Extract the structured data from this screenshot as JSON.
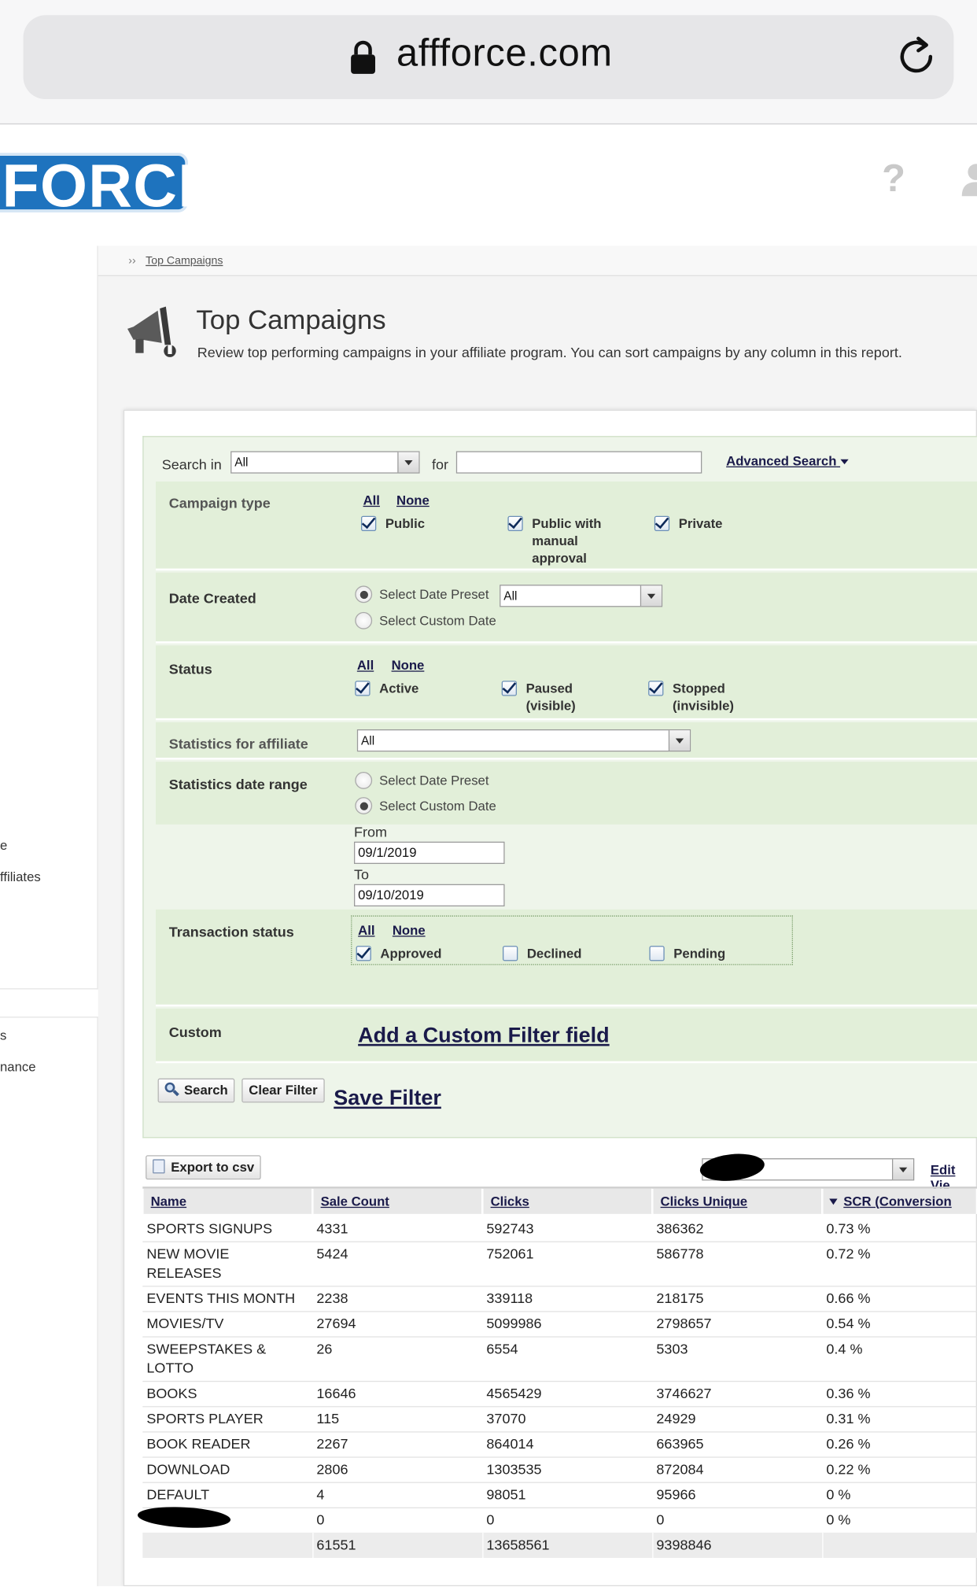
{
  "browser": {
    "url": "affforce.com"
  },
  "header": {
    "logo_text": "FORCE",
    "help_glyph": "?"
  },
  "sidebar": {
    "frag1": "e",
    "frag2": "ffiliates",
    "frag3": "s",
    "frag4": "nance"
  },
  "breadcrumb": {
    "arrow": "››",
    "current": "Top Campaigns"
  },
  "page": {
    "title": "Top Campaigns",
    "description": "Review top performing campaigns in your affiliate program. You can sort campaigns by any column in this report."
  },
  "search": {
    "label": "Search in",
    "scope_value": "All",
    "for_label": "for",
    "query_value": "",
    "advanced_label": "Advanced Search"
  },
  "filters": {
    "campaign_type": {
      "label": "Campaign type",
      "all": "All",
      "none": "None",
      "options": [
        {
          "line1": "Public",
          "line2": "",
          "line3": "",
          "checked": true
        },
        {
          "line1": "Public with",
          "line2": "manual",
          "line3": "approval",
          "checked": true
        },
        {
          "line1": "Private",
          "line2": "",
          "line3": "",
          "checked": true
        }
      ]
    },
    "date_created": {
      "label": "Date Created",
      "preset_label": "Select Date Preset",
      "preset_value": "All",
      "custom_label": "Select Custom Date",
      "selected": "preset"
    },
    "status": {
      "label": "Status",
      "all": "All",
      "none": "None",
      "options": [
        {
          "line1": "Active",
          "line2": "",
          "checked": true
        },
        {
          "line1": "Paused",
          "line2": "(visible)",
          "checked": true
        },
        {
          "line1": "Stopped",
          "line2": "(invisible)",
          "checked": true
        }
      ]
    },
    "affiliate": {
      "label": "Statistics for affiliate",
      "value": "All"
    },
    "stats_range": {
      "label": "Statistics date range",
      "preset_label": "Select Date Preset",
      "custom_label": "Select Custom Date",
      "selected": "custom",
      "from_label": "From",
      "from_value": "09/1/2019",
      "to_label": "To",
      "to_value": "09/10/2019"
    },
    "transaction": {
      "label": "Transaction status",
      "all": "All",
      "none": "None",
      "options": [
        {
          "label": "Approved",
          "checked": true
        },
        {
          "label": "Declined",
          "checked": false
        },
        {
          "label": "Pending",
          "checked": false
        }
      ]
    },
    "custom": {
      "label": "Custom",
      "add_label": "Add a Custom Filter field"
    }
  },
  "actions": {
    "search_label": "Search",
    "clear_label": "Clear Filter",
    "save_label": "Save Filter"
  },
  "results": {
    "export_label": "Export to csv",
    "view_select_value": "",
    "edit_view_label": "Edit Vie",
    "columns": [
      "Name",
      "Sale Count",
      "Clicks",
      "Clicks Unique",
      "SCR (Conversion"
    ],
    "rows": [
      {
        "name1": "SPORTS SIGNUPS",
        "name2": "",
        "sales": "4331",
        "clicks": "592743",
        "unique": "386362",
        "scr": "0.73 %"
      },
      {
        "name1": "NEW MOVIE",
        "name2": "RELEASES",
        "sales": "5424",
        "clicks": "752061",
        "unique": "586778",
        "scr": "0.72 %"
      },
      {
        "name1": "EVENTS THIS MONTH",
        "name2": "",
        "sales": "2238",
        "clicks": "339118",
        "unique": "218175",
        "scr": "0.66 %"
      },
      {
        "name1": "MOVIES/TV",
        "name2": "",
        "sales": "27694",
        "clicks": "5099986",
        "unique": "2798657",
        "scr": "0.54 %"
      },
      {
        "name1": "SWEEPSTAKES &",
        "name2": "LOTTO",
        "sales": "26",
        "clicks": "6554",
        "unique": "5303",
        "scr": "0.4 %"
      },
      {
        "name1": "BOOKS",
        "name2": "",
        "sales": "16646",
        "clicks": "4565429",
        "unique": "3746627",
        "scr": "0.36 %"
      },
      {
        "name1": "SPORTS PLAYER",
        "name2": "",
        "sales": "115",
        "clicks": "37070",
        "unique": "24929",
        "scr": "0.31 %"
      },
      {
        "name1": "BOOK READER",
        "name2": "",
        "sales": "2267",
        "clicks": "864014",
        "unique": "663965",
        "scr": "0.26 %"
      },
      {
        "name1": "DOWNLOAD",
        "name2": "",
        "sales": "2806",
        "clicks": "1303535",
        "unique": "872084",
        "scr": "0.22 %"
      },
      {
        "name1": "DEFAULT",
        "name2": "",
        "sales": "4",
        "clicks": "98051",
        "unique": "95966",
        "scr": "0 %"
      },
      {
        "name1": "",
        "name2": "",
        "sales": "0",
        "clicks": "0",
        "unique": "0",
        "scr": "0 %"
      }
    ],
    "totals": {
      "sales": "61551",
      "clicks": "13658561",
      "unique": "9398846"
    }
  },
  "colors": {
    "brand_blue": "#1e73be",
    "filter_bg": "#eef5ea",
    "filter_band": "#e2efd9",
    "link": "#1a1a4a"
  }
}
